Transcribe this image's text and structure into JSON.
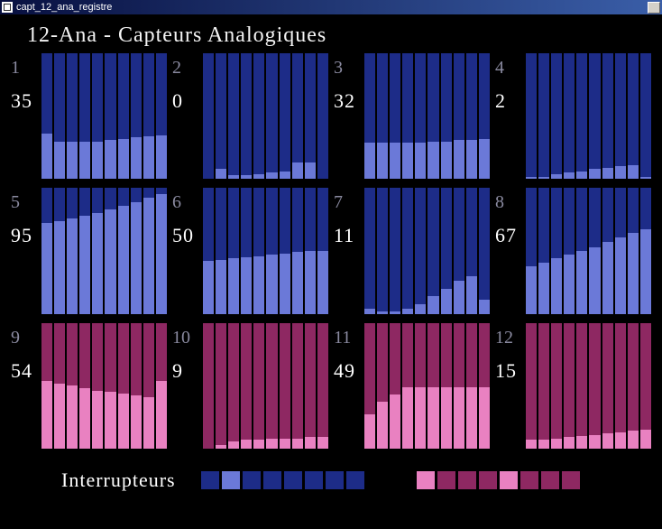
{
  "window": {
    "title": "capt_12_ana_registre"
  },
  "page_title": "12-Ana - Capteurs Analogiques",
  "footer_label": "Interrupteurs",
  "colors": {
    "blue_dark": "#1d2c88",
    "blue_light": "#6b79d8",
    "mag_dark": "#8e2862",
    "mag_light": "#e981c1"
  },
  "swatches_left": [
    "#1d2c88",
    "#6b79d8",
    "#1d2c88",
    "#1d2c88",
    "#1d2c88",
    "#1d2c88",
    "#1d2c88",
    "#1d2c88"
  ],
  "swatches_right": [
    "#e981c1",
    "#8e2862",
    "#8e2862",
    "#8e2862",
    "#e981c1",
    "#8e2862",
    "#8e2862",
    "#8e2862"
  ],
  "chart_data": [
    {
      "id": "1",
      "value": "35",
      "palette": "blue",
      "type": "bar",
      "bars": [
        36,
        30,
        30,
        30,
        30,
        31,
        32,
        33,
        34,
        35
      ]
    },
    {
      "id": "2",
      "value": "0",
      "palette": "blue",
      "type": "bar",
      "bars": [
        0,
        8,
        3,
        3,
        4,
        5,
        6,
        13,
        13,
        0
      ]
    },
    {
      "id": "3",
      "value": "32",
      "palette": "blue",
      "type": "bar",
      "bars": [
        29,
        29,
        29,
        29,
        29,
        30,
        30,
        31,
        31,
        32
      ]
    },
    {
      "id": "4",
      "value": "2",
      "palette": "blue",
      "type": "bar",
      "bars": [
        2,
        2,
        4,
        5,
        6,
        8,
        9,
        10,
        11,
        2
      ]
    },
    {
      "id": "5",
      "value": "95",
      "palette": "blue",
      "type": "bar",
      "bars": [
        72,
        74,
        76,
        78,
        80,
        83,
        86,
        89,
        92,
        95
      ]
    },
    {
      "id": "6",
      "value": "50",
      "palette": "blue",
      "type": "bar",
      "bars": [
        42,
        43,
        44,
        45,
        46,
        47,
        48,
        49,
        50,
        50
      ]
    },
    {
      "id": "7",
      "value": "11",
      "palette": "blue",
      "type": "bar",
      "bars": [
        4,
        2,
        2,
        4,
        8,
        14,
        20,
        26,
        30,
        11
      ]
    },
    {
      "id": "8",
      "value": "67",
      "palette": "blue",
      "type": "bar",
      "bars": [
        38,
        41,
        44,
        47,
        50,
        53,
        57,
        61,
        64,
        67
      ]
    },
    {
      "id": "9",
      "value": "54",
      "palette": "mag",
      "type": "bar",
      "bars": [
        54,
        52,
        50,
        48,
        46,
        45,
        44,
        42,
        41,
        54
      ]
    },
    {
      "id": "10",
      "value": "9",
      "palette": "mag",
      "type": "bar",
      "bars": [
        0,
        3,
        6,
        7,
        7,
        8,
        8,
        8,
        9,
        9
      ]
    },
    {
      "id": "11",
      "value": "49",
      "palette": "mag",
      "type": "bar",
      "bars": [
        27,
        37,
        43,
        49,
        49,
        49,
        49,
        49,
        49,
        49
      ]
    },
    {
      "id": "12",
      "value": "15",
      "palette": "mag",
      "type": "bar",
      "bars": [
        7,
        7,
        8,
        9,
        10,
        11,
        12,
        13,
        14,
        15
      ]
    }
  ]
}
